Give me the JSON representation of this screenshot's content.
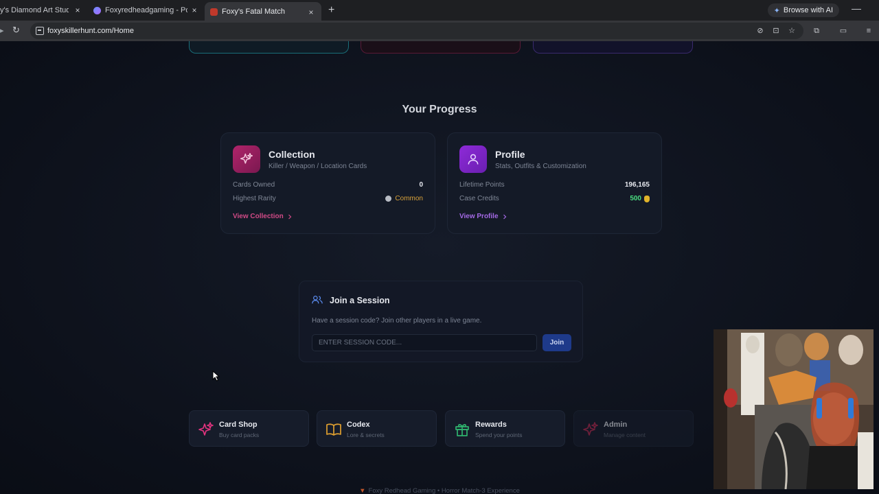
{
  "browser": {
    "tabs": [
      {
        "title": "y's Diamond Art Studio",
        "active": false
      },
      {
        "title": "Foxyredheadgaming - Poster (U",
        "active": false
      },
      {
        "title": "Foxy's Fatal Match",
        "active": true
      }
    ],
    "close_glyph": "×",
    "new_tab_glyph": "+",
    "ai_button": "Browse with AI",
    "url": "foxyskillerhunt.com/Home"
  },
  "progress": {
    "title": "Your Progress",
    "collection": {
      "title": "Collection",
      "subtitle": "Killer / Weapon / Location Cards",
      "cards_owned_label": "Cards Owned",
      "cards_owned_value": "0",
      "highest_rarity_label": "Highest Rarity",
      "highest_rarity_value": "Common",
      "link": "View Collection"
    },
    "profile": {
      "title": "Profile",
      "subtitle": "Stats, Outfits & Customization",
      "lifetime_points_label": "Lifetime Points",
      "lifetime_points_value": "196,165",
      "case_credits_label": "Case Credits",
      "case_credits_value": "500",
      "link": "View Profile"
    }
  },
  "session": {
    "title": "Join a Session",
    "description": "Have a session code? Join other players in a live game.",
    "placeholder": "ENTER SESSION CODE...",
    "button": "Join"
  },
  "quick_links": [
    {
      "title": "Card Shop",
      "subtitle": "Buy card packs",
      "icon": "sparkle-icon",
      "color": "#e0337e"
    },
    {
      "title": "Codex",
      "subtitle": "Lore & secrets",
      "icon": "book-icon",
      "color": "#e0a030"
    },
    {
      "title": "Rewards",
      "subtitle": "Spend your points",
      "icon": "gift-icon",
      "color": "#2fb36e"
    },
    {
      "title": "Admin",
      "subtitle": "Manage content",
      "icon": "sparkle-icon",
      "color": "#c02a52"
    }
  ],
  "footer": "Foxy Redhead Gaming • Horror Match-3 Experience",
  "colors": {
    "collection_accent": "#b0246a",
    "profile_accent": "#8e2ad8",
    "join_button": "#1e3a8a",
    "credits": "#4ade80",
    "rarity": "#d9a23a"
  }
}
